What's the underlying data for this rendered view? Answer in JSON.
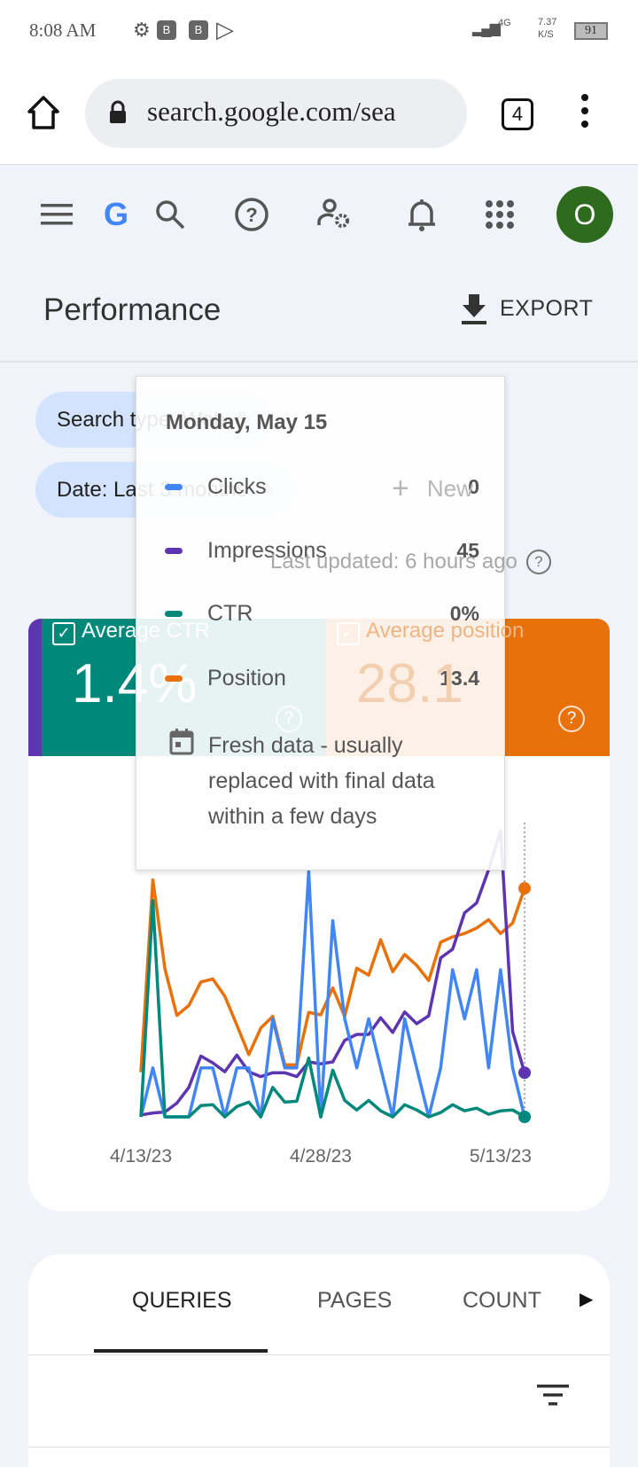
{
  "status_bar": {
    "time": "8:08 AM",
    "network": "4G",
    "speed": "7.37",
    "speed_unit": "K/S",
    "battery": "91"
  },
  "browser": {
    "url": "search.google.com/sea",
    "tab_count": "4"
  },
  "header": {
    "avatar_letter": "O",
    "page_title": "Performance",
    "export_label": "EXPORT"
  },
  "filters": {
    "search_type": "Search type: Web",
    "date": "Date: Last 3 months",
    "new_label": "New",
    "last_updated": "Last updated: 6 hours ago"
  },
  "metrics": [
    {
      "label": "Average CTR",
      "value": "1.4%",
      "color": "#00897b",
      "checked": true
    },
    {
      "label": "Average position",
      "value": "28.1",
      "color": "#e8710a",
      "checked": true
    }
  ],
  "tooltip": {
    "date": "Monday, May 15",
    "rows": [
      {
        "name": "Clicks",
        "value": "0",
        "color": "#4285f4"
      },
      {
        "name": "Impressions",
        "value": "45",
        "color": "#5e35b1"
      },
      {
        "name": "CTR",
        "value": "0%",
        "color": "#00897b"
      },
      {
        "name": "Position",
        "value": "13.4",
        "color": "#e8710a"
      }
    ],
    "note": "Fresh data - usually replaced with final data within a few days"
  },
  "chart_data": {
    "type": "line",
    "x_start": "4/13/23",
    "x_end": "5/15/23",
    "x_tick_labels": [
      "4/13/23",
      "4/28/23",
      "5/13/23"
    ],
    "grid": false,
    "series": [
      {
        "name": "Clicks",
        "color": "#4285f4",
        "ylim": [
          0,
          6
        ],
        "values": [
          0,
          1,
          0,
          0,
          0,
          1,
          1,
          0,
          1,
          1,
          0,
          2,
          1,
          1,
          5,
          0,
          4,
          2,
          1,
          2,
          1,
          0,
          2,
          1,
          0,
          1,
          3,
          2,
          3,
          1,
          3,
          1,
          0
        ]
      },
      {
        "name": "Impressions",
        "color": "#5e35b1",
        "ylim": [
          0,
          300
        ],
        "values": [
          2,
          4,
          5,
          14,
          30,
          62,
          55,
          46,
          63,
          46,
          41,
          45,
          45,
          41,
          56,
          54,
          56,
          78,
          84,
          84,
          101,
          86,
          107,
          95,
          103,
          162,
          171,
          208,
          218,
          252,
          292,
          87,
          45
        ]
      },
      {
        "name": "CTR",
        "color": "#00897b",
        "ylim": [
          0,
          34
        ],
        "values": [
          0,
          25,
          0,
          0,
          0,
          1.3,
          1.4,
          0,
          1.2,
          1.7,
          0,
          3.4,
          1.7,
          1.8,
          6.8,
          0,
          5.4,
          1.9,
          0.8,
          1.9,
          0.7,
          0,
          1.4,
          0.8,
          0,
          0.5,
          1.4,
          0.7,
          1.0,
          0.3,
          0.7,
          0.8,
          0
        ]
      },
      {
        "name": "Position",
        "color": "#e8710a",
        "ylim": [
          60,
          0
        ],
        "values": [
          50.9,
          11.7,
          29.8,
          39.3,
          37.3,
          32.5,
          31.9,
          35.4,
          41.3,
          47.3,
          41.9,
          39.5,
          49.4,
          49.4,
          38.7,
          39.2,
          33.7,
          39.5,
          29.7,
          31.1,
          23.9,
          30.4,
          26.9,
          29.1,
          32.2,
          24.4,
          23.3,
          22.6,
          21.5,
          19.8,
          22.6,
          20.5,
          13.4
        ]
      }
    ]
  },
  "tabs": {
    "items": [
      "QUERIES",
      "PAGES",
      "COUNT"
    ],
    "active": "QUERIES"
  }
}
